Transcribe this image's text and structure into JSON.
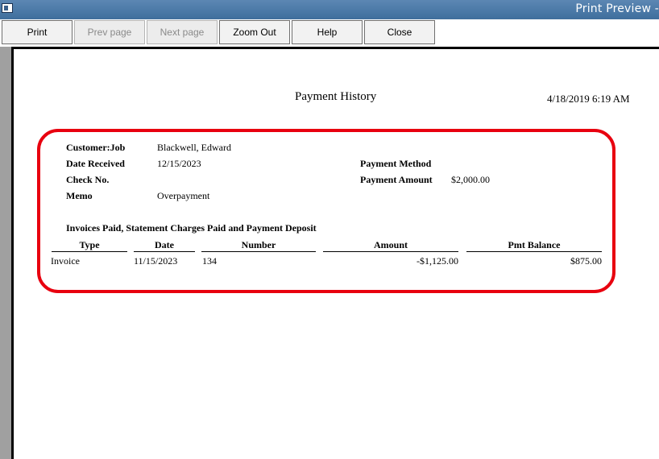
{
  "window": {
    "title": "Print Preview -"
  },
  "toolbar": {
    "print": "Print",
    "prev_page": "Prev page",
    "next_page": "Next page",
    "zoom_out": "Zoom Out",
    "help": "Help",
    "close": "Close"
  },
  "report": {
    "title": "Payment History",
    "printed_at": "4/18/2019 6:19 AM",
    "fields": {
      "customer_job_label": "Customer:Job",
      "customer_job_value": "Blackwell, Edward",
      "date_received_label": "Date Received",
      "date_received_value": "12/15/2023",
      "check_no_label": "Check No.",
      "memo_label": "Memo",
      "memo_value": "Overpayment",
      "payment_method_label": "Payment Method",
      "payment_amount_label": "Payment Amount",
      "payment_amount_value": "$2,000.00"
    },
    "section_title": "Invoices Paid, Statement Charges Paid and Payment Deposit",
    "columns": [
      "Type",
      "Date",
      "Number",
      "Amount",
      "Pmt Balance"
    ],
    "rows": [
      {
        "type": "Invoice",
        "date": "11/15/2023",
        "number": "134",
        "amount": "-$1,125.00",
        "pmt_balance": "$875.00"
      }
    ]
  },
  "colors": {
    "highlight": "#e8000f",
    "titlebar": "#4a78a6"
  }
}
